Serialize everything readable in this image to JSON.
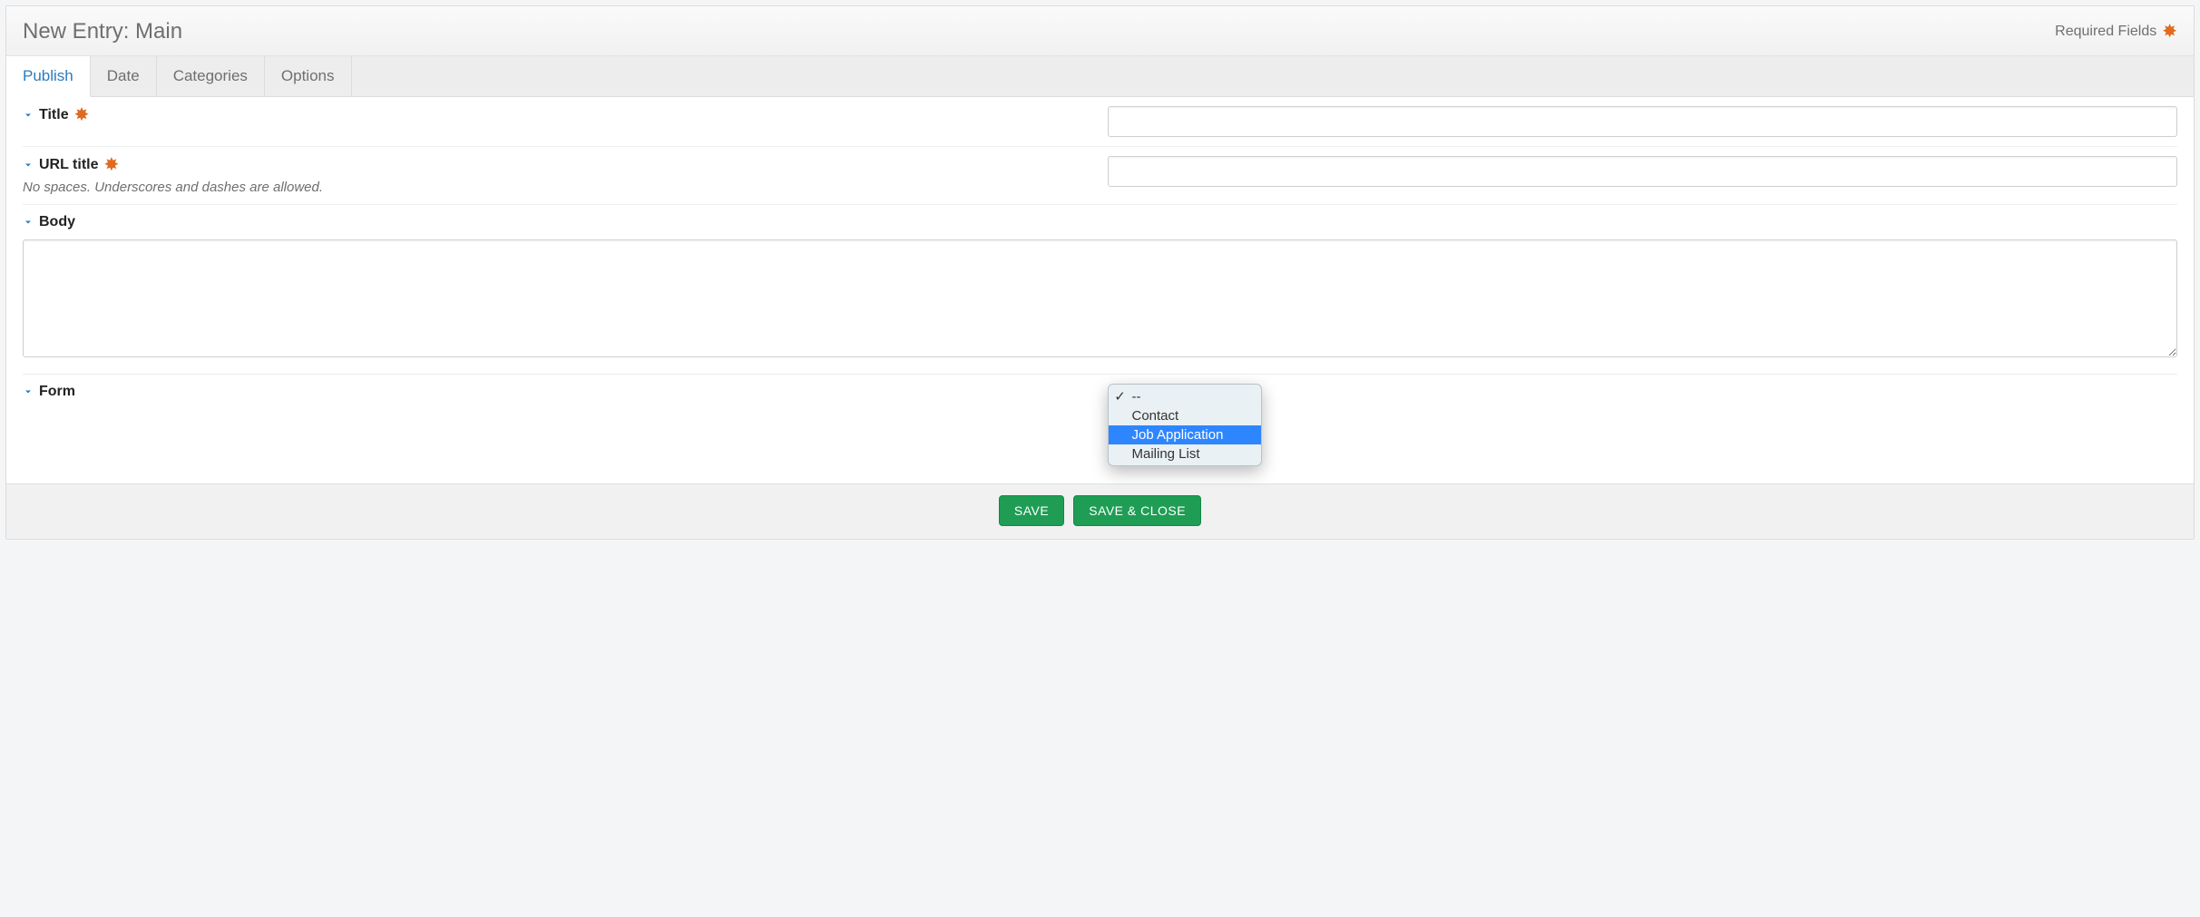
{
  "header": {
    "title": "New Entry: Main",
    "required_label": "Required Fields"
  },
  "tabs": [
    {
      "label": "Publish",
      "active": true
    },
    {
      "label": "Date",
      "active": false
    },
    {
      "label": "Categories",
      "active": false
    },
    {
      "label": "Options",
      "active": false
    }
  ],
  "fields": {
    "title": {
      "label": "Title",
      "required": true,
      "value": ""
    },
    "url_title": {
      "label": "URL title",
      "required": true,
      "help": "No spaces. Underscores and dashes are allowed.",
      "value": ""
    },
    "body": {
      "label": "Body",
      "value": ""
    },
    "form": {
      "label": "Form",
      "selected": "--",
      "highlighted": "Job Application",
      "options": [
        "--",
        "Contact",
        "Job Application",
        "Mailing List"
      ]
    }
  },
  "footer": {
    "save": "SAVE",
    "save_close": "SAVE & CLOSE"
  }
}
